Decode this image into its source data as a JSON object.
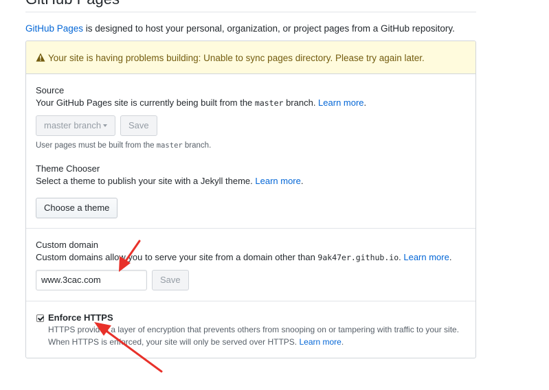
{
  "page": {
    "heading": "GitHub Pages",
    "intro_link": "GitHub Pages",
    "intro_text": " is designed to host your personal, organization, or project pages from a GitHub repository."
  },
  "flash": {
    "message": "Your site is having problems building: Unable to sync pages directory. Please try again later.",
    "icon": "alert-icon"
  },
  "source": {
    "label": "Source",
    "desc_before": "Your GitHub Pages site is currently being built from the ",
    "desc_code": "master",
    "desc_after": " branch. ",
    "learn_more": "Learn more",
    "desc_end": ".",
    "branch_select": "master branch",
    "save": "Save",
    "note_before": "User pages must be built from the ",
    "note_code": "master",
    "note_after": " branch."
  },
  "theme": {
    "label": "Theme Chooser",
    "desc": "Select a theme to publish your site with a Jekyll theme. ",
    "learn_more": "Learn more",
    "desc_end": ".",
    "button": "Choose a theme"
  },
  "custom_domain": {
    "label": "Custom domain",
    "desc_before": "Custom domains allow you to serve your site from a domain other than ",
    "desc_code": "9ak47er.github.io",
    "desc_after": ". ",
    "learn_more": "Learn more",
    "desc_end": ".",
    "value": "www.3cac.com",
    "save": "Save"
  },
  "https": {
    "label": "Enforce HTTPS",
    "checked": true,
    "line1": "HTTPS provides a layer of encryption that prevents others from snooping on or tampering with traffic to your site.",
    "line2": "When HTTPS is enforced, your site will only be served over HTTPS. ",
    "learn_more": "Learn more",
    "end": "."
  },
  "colors": {
    "link": "#0366d6",
    "flash_bg": "#fffbdd",
    "annotation_arrow": "#e8312a"
  }
}
